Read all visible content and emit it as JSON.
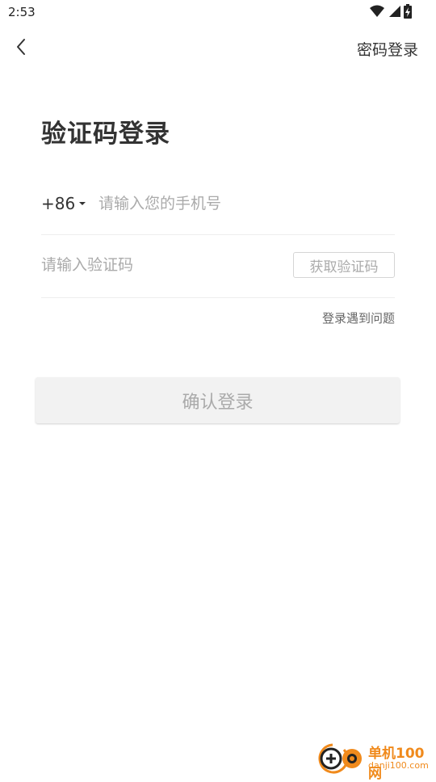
{
  "status_bar": {
    "time": "2:53"
  },
  "header": {
    "back_icon": "chevron-left-icon",
    "password_login": "密码登录"
  },
  "title": "验证码登录",
  "phone": {
    "country_code": "+86",
    "placeholder": "请输入您的手机号"
  },
  "code": {
    "placeholder": "请输入验证码",
    "get_code_label": "获取验证码"
  },
  "login_problem": "登录遇到问题",
  "confirm_label": "确认登录",
  "watermark": {
    "name": "单机100网",
    "url": "danji100.com"
  },
  "colors": {
    "text_primary": "#333333",
    "placeholder": "#aaaaaa",
    "divider": "#eeeeee",
    "button_disabled_bg": "#f2f2f2",
    "watermark_orange": "#f08a1c"
  }
}
